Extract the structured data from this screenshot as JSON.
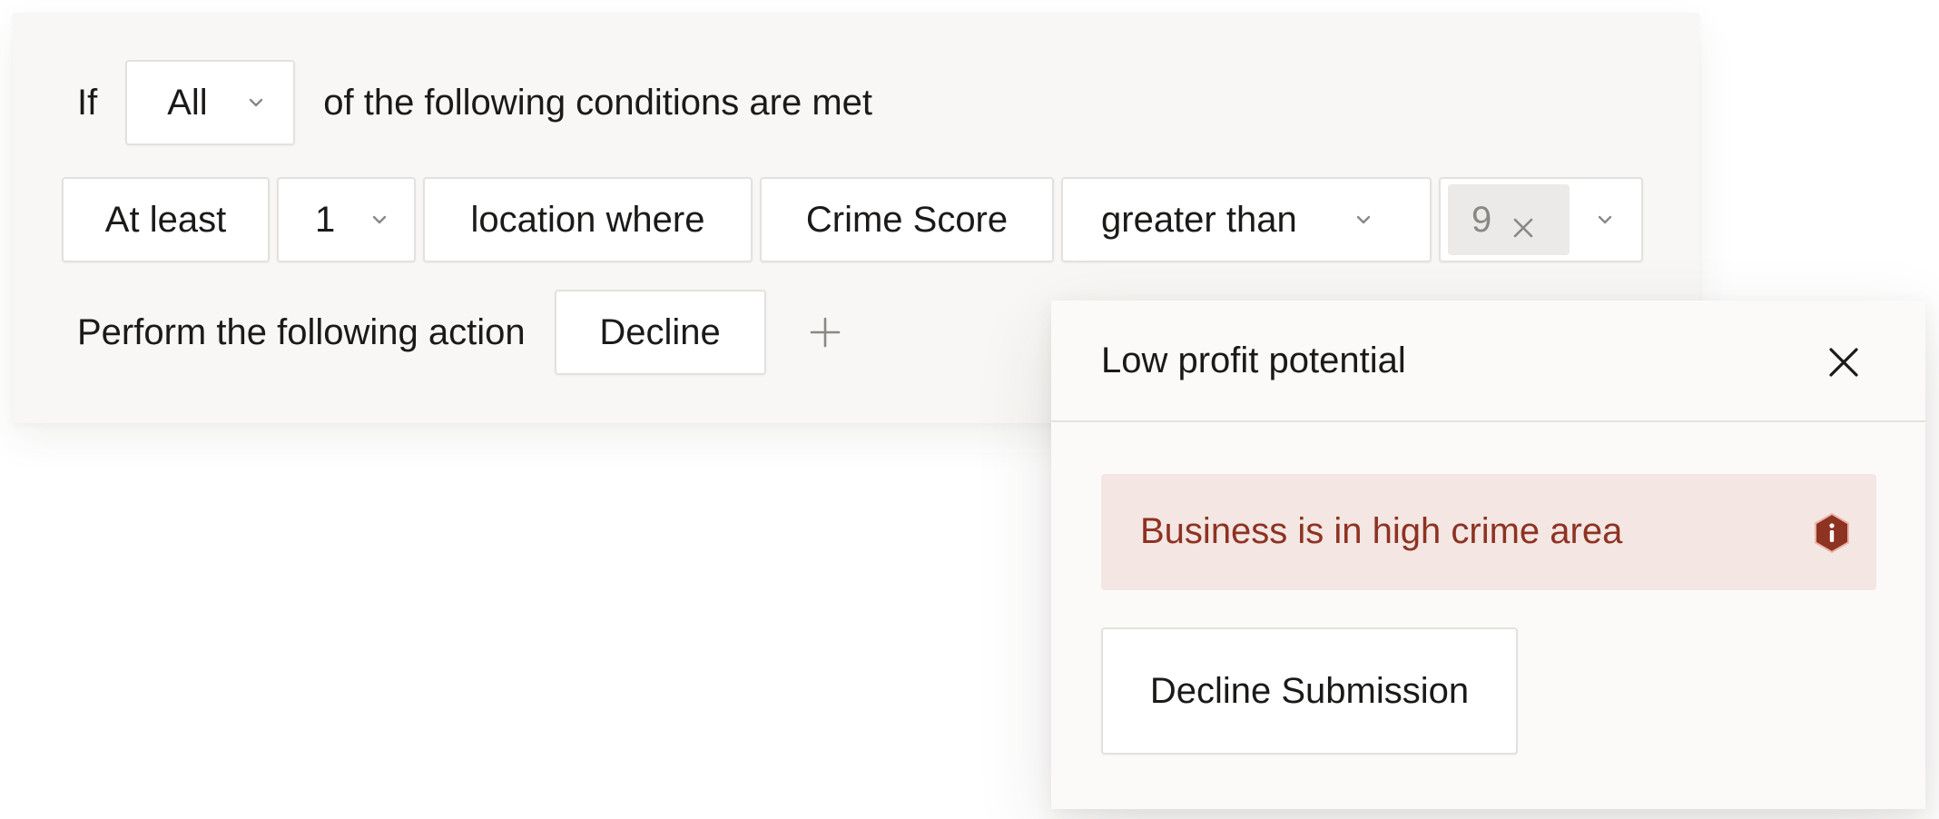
{
  "rule": {
    "if_label": "If",
    "match_mode": "All",
    "conditions_text": "of the following conditions are met",
    "condition": {
      "quantifier": "At least",
      "count": "1",
      "subject": "location where",
      "field": "Crime Score",
      "operator": "greater than",
      "value_tag": "9"
    },
    "action_label": "Perform the following action",
    "action": "Decline"
  },
  "popover": {
    "title": "Low profit potential",
    "alert_text": "Business is in high crime area",
    "button_label": "Decline Submission"
  },
  "icons": {
    "dropdown": "chevron-down-icon",
    "remove": "close-icon",
    "add": "plus-icon",
    "close": "close-icon",
    "alert": "info-hexagon-icon"
  },
  "colors": {
    "panel_background": "#f8f7f5",
    "alert_background": "#f3e6e3",
    "alert_text": "#8e3222",
    "alert_icon": "#8e3222",
    "tag_background": "#ebeae8"
  }
}
